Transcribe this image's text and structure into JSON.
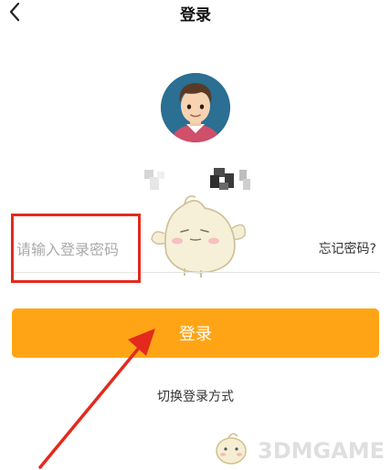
{
  "header": {
    "title": "登录",
    "back_icon": "chevron-left-icon"
  },
  "login_form": {
    "password_placeholder": "请输入登录密码",
    "forgot_password": "忘记密码?",
    "submit_label": "登录",
    "switch_method": "切换登录方式"
  },
  "colors": {
    "accent": "#ffa515",
    "highlight": "#e32a1d"
  },
  "watermark": {
    "text": "3DMGAME"
  }
}
